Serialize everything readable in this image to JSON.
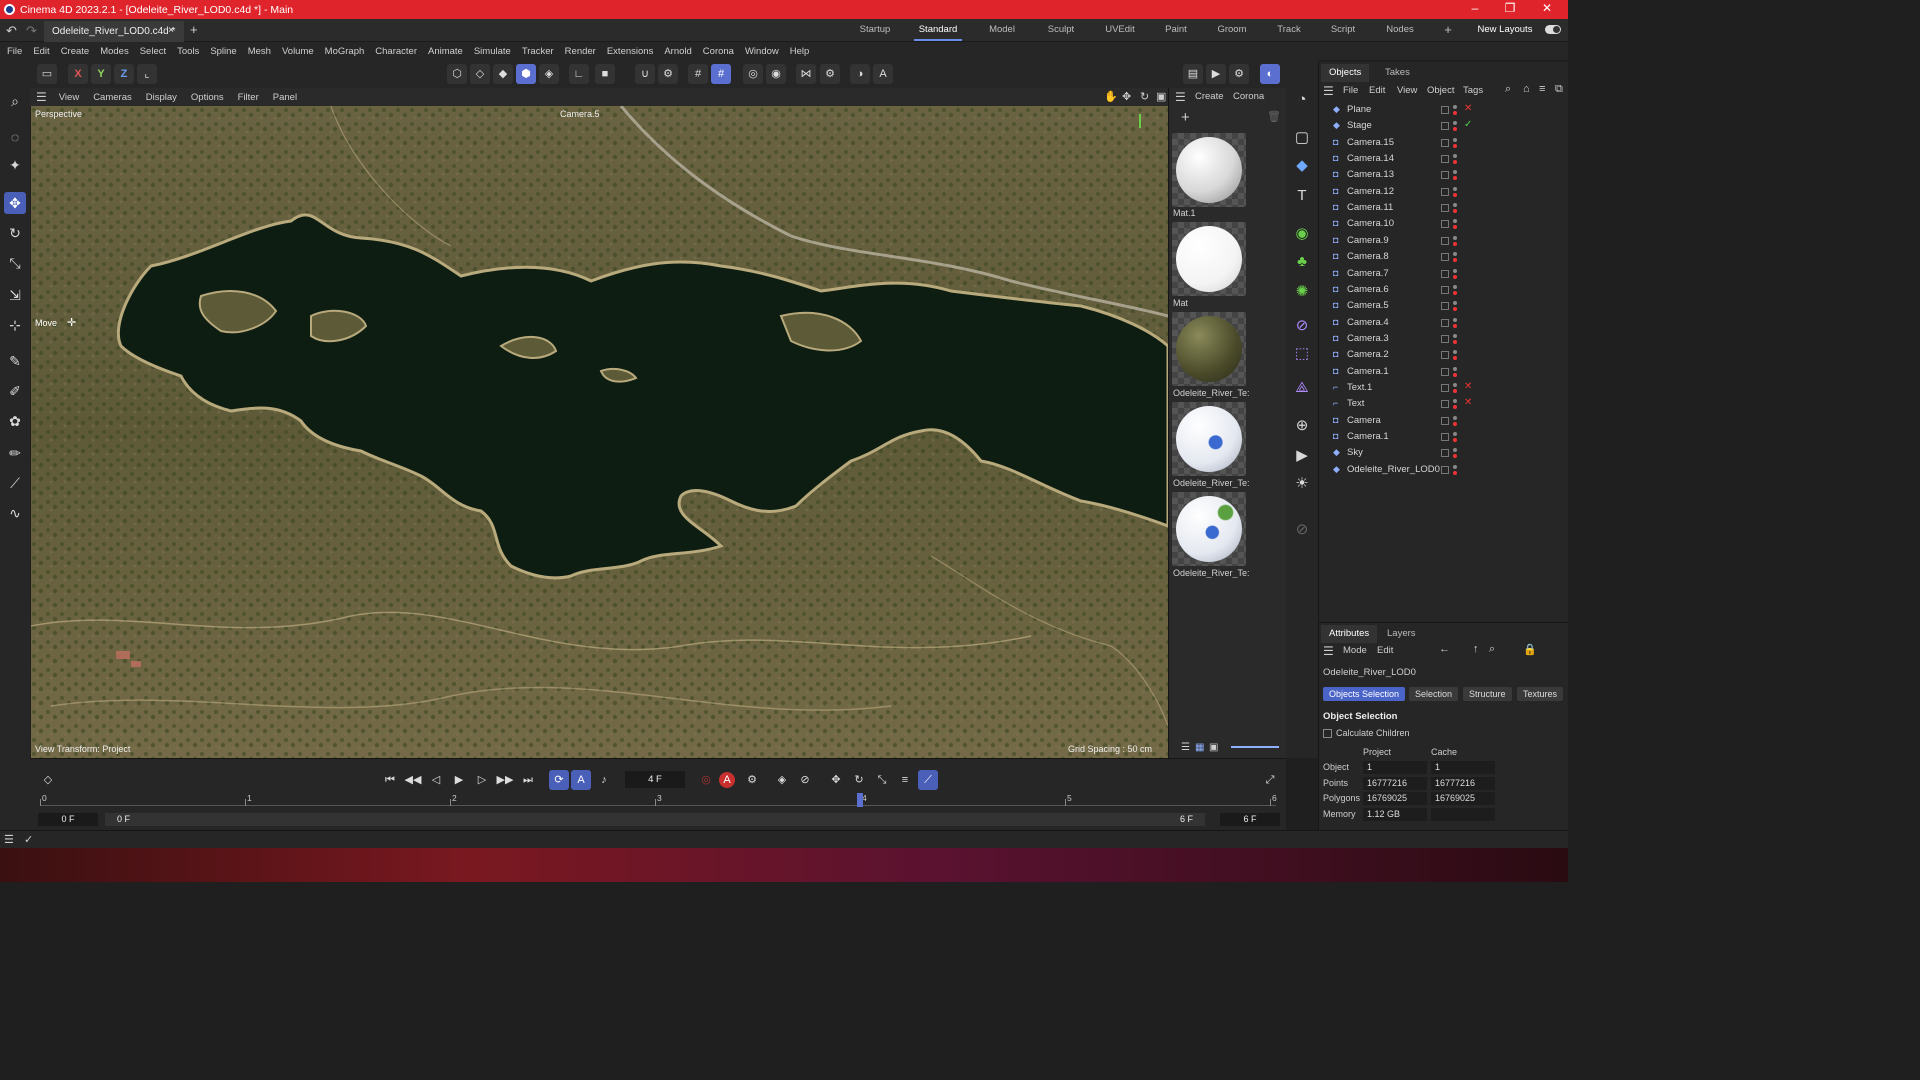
{
  "window": {
    "title": "Cinema 4D 2023.2.1 - [Odeleite_River_LOD0.c4d *] - Main",
    "controls": [
      "–",
      "❐",
      "✕"
    ]
  },
  "doc_tab": {
    "label": "Odeleite_River_LOD0.c4d *",
    "close": "×",
    "add": "+"
  },
  "layouts": {
    "items": [
      "Startup",
      "Standard",
      "Model",
      "Sculpt",
      "UVEdit",
      "Paint",
      "Groom",
      "Track",
      "Script",
      "Nodes"
    ],
    "active": "Standard",
    "add": "+",
    "new_layouts": "New Layouts"
  },
  "menu": [
    "File",
    "Edit",
    "Create",
    "Modes",
    "Select",
    "Tools",
    "Spline",
    "Mesh",
    "Volume",
    "MoGraph",
    "Character",
    "Animate",
    "Simulate",
    "Tracker",
    "Render",
    "Extensions",
    "Arnold",
    "Corona",
    "Window",
    "Help"
  ],
  "axis_buttons": [
    "X",
    "Y",
    "Z"
  ],
  "viewport": {
    "menu": [
      "View",
      "Cameras",
      "Display",
      "Options",
      "Filter",
      "Panel"
    ],
    "projection": "Perspective",
    "camera": "Camera.5",
    "tool_label": "Move",
    "view_transform": "View Transform: Project",
    "grid_spacing": "Grid Spacing : 50 cm"
  },
  "material_panel": {
    "menu": [
      "Create",
      "Corona"
    ],
    "materials": [
      {
        "label": "Mat.1",
        "kind": "white-checker"
      },
      {
        "label": "Mat",
        "kind": "white"
      },
      {
        "label": "Odeleite_River_Te:",
        "kind": "terrain"
      },
      {
        "label": "Odeleite_River_Te:",
        "kind": "blue-river"
      },
      {
        "label": "Odeleite_River_Te:",
        "kind": "blue-river-green"
      }
    ]
  },
  "objects_panel": {
    "tabs": [
      "Objects",
      "Takes"
    ],
    "menu": [
      "File",
      "Edit",
      "View",
      "Object",
      "Tags"
    ],
    "items": [
      {
        "name": "Plane",
        "status": "✕"
      },
      {
        "name": "Stage",
        "status": "✓"
      },
      {
        "name": "Camera.15",
        "status": ""
      },
      {
        "name": "Camera.14",
        "status": ""
      },
      {
        "name": "Camera.13",
        "status": ""
      },
      {
        "name": "Camera.12",
        "status": ""
      },
      {
        "name": "Camera.11",
        "status": ""
      },
      {
        "name": "Camera.10",
        "status": ""
      },
      {
        "name": "Camera.9",
        "status": ""
      },
      {
        "name": "Camera.8",
        "status": ""
      },
      {
        "name": "Camera.7",
        "status": ""
      },
      {
        "name": "Camera.6",
        "status": ""
      },
      {
        "name": "Camera.5",
        "status": ""
      },
      {
        "name": "Camera.4",
        "status": ""
      },
      {
        "name": "Camera.3",
        "status": ""
      },
      {
        "name": "Camera.2",
        "status": ""
      },
      {
        "name": "Camera.1",
        "status": ""
      },
      {
        "name": "Text.1",
        "status": "✕"
      },
      {
        "name": "Text",
        "status": "✕"
      },
      {
        "name": "Camera",
        "status": ""
      },
      {
        "name": "Camera.1",
        "status": ""
      },
      {
        "name": "Sky",
        "status": ""
      },
      {
        "name": "Odeleite_River_LOD0",
        "status": ""
      }
    ]
  },
  "attributes": {
    "tabs": [
      "Attributes",
      "Layers"
    ],
    "menu": [
      "Mode",
      "Edit"
    ],
    "object_name": "Odeleite_River_LOD0",
    "buttons": [
      "Objects Selection",
      "Selection",
      "Structure",
      "Textures"
    ],
    "active_button": "Objects Selection",
    "section": "Object Selection",
    "calc_children": "Calculate Children",
    "col_project": "Project",
    "col_cache": "Cache",
    "rows": [
      {
        "label": "Object",
        "project": "1",
        "cache": "1"
      },
      {
        "label": "Points",
        "project": "16777216",
        "cache": "16777216"
      },
      {
        "label": "Polygons",
        "project": "16769025",
        "cache": "16769025"
      },
      {
        "label": "Memory",
        "project": "1.12 GB",
        "cache": ""
      }
    ]
  },
  "timeline": {
    "current_frame": "4 F",
    "ticks": [
      "0",
      "1",
      "2",
      "3",
      "4",
      "5",
      "6"
    ],
    "start_field": "0 F",
    "range_start": "0 F",
    "range_end": "6 F",
    "end_field": "6 F",
    "current_value": 4,
    "max_value": 6
  },
  "colors": {
    "titlebar": "#e0242b",
    "accent": "#5b6fd0",
    "panel": "#262626",
    "water": "#0d1d12"
  }
}
